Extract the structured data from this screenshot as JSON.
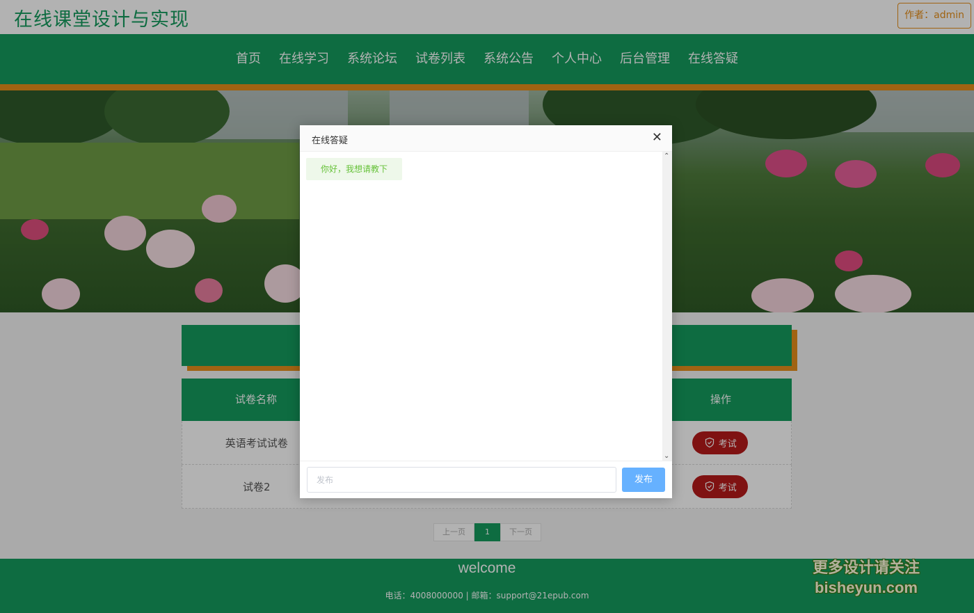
{
  "header": {
    "site_title": "在线课堂设计与实现",
    "author_label": "作者：admin"
  },
  "nav": {
    "items": [
      "首页",
      "在线学习",
      "系统论坛",
      "试卷列表",
      "系统公告",
      "个人中心",
      "后台管理",
      "在线答疑"
    ]
  },
  "table": {
    "headers": {
      "name": "试卷名称",
      "op": "操作"
    },
    "rows": [
      {
        "name": "英语考试试卷",
        "action": "考试"
      },
      {
        "name": "试卷2",
        "action": "考试"
      }
    ]
  },
  "pagination": {
    "prev": "上一页",
    "current": "1",
    "next": "下一页"
  },
  "footer": {
    "welcome": "welcome",
    "contact": "电话：4008000000 | 邮箱：support@21epub.com"
  },
  "watermark": {
    "line1": "更多设计请关注",
    "line2": "bisheyun.com"
  },
  "modal": {
    "title": "在线答疑",
    "messages": [
      "你好，我想请教下"
    ],
    "input_placeholder": "发布",
    "send_label": "发布"
  },
  "colors": {
    "primary_green": "#159b5e",
    "accent_orange": "#e58e1a",
    "exam_red": "#b71b1b",
    "send_blue": "#66b1ff"
  }
}
